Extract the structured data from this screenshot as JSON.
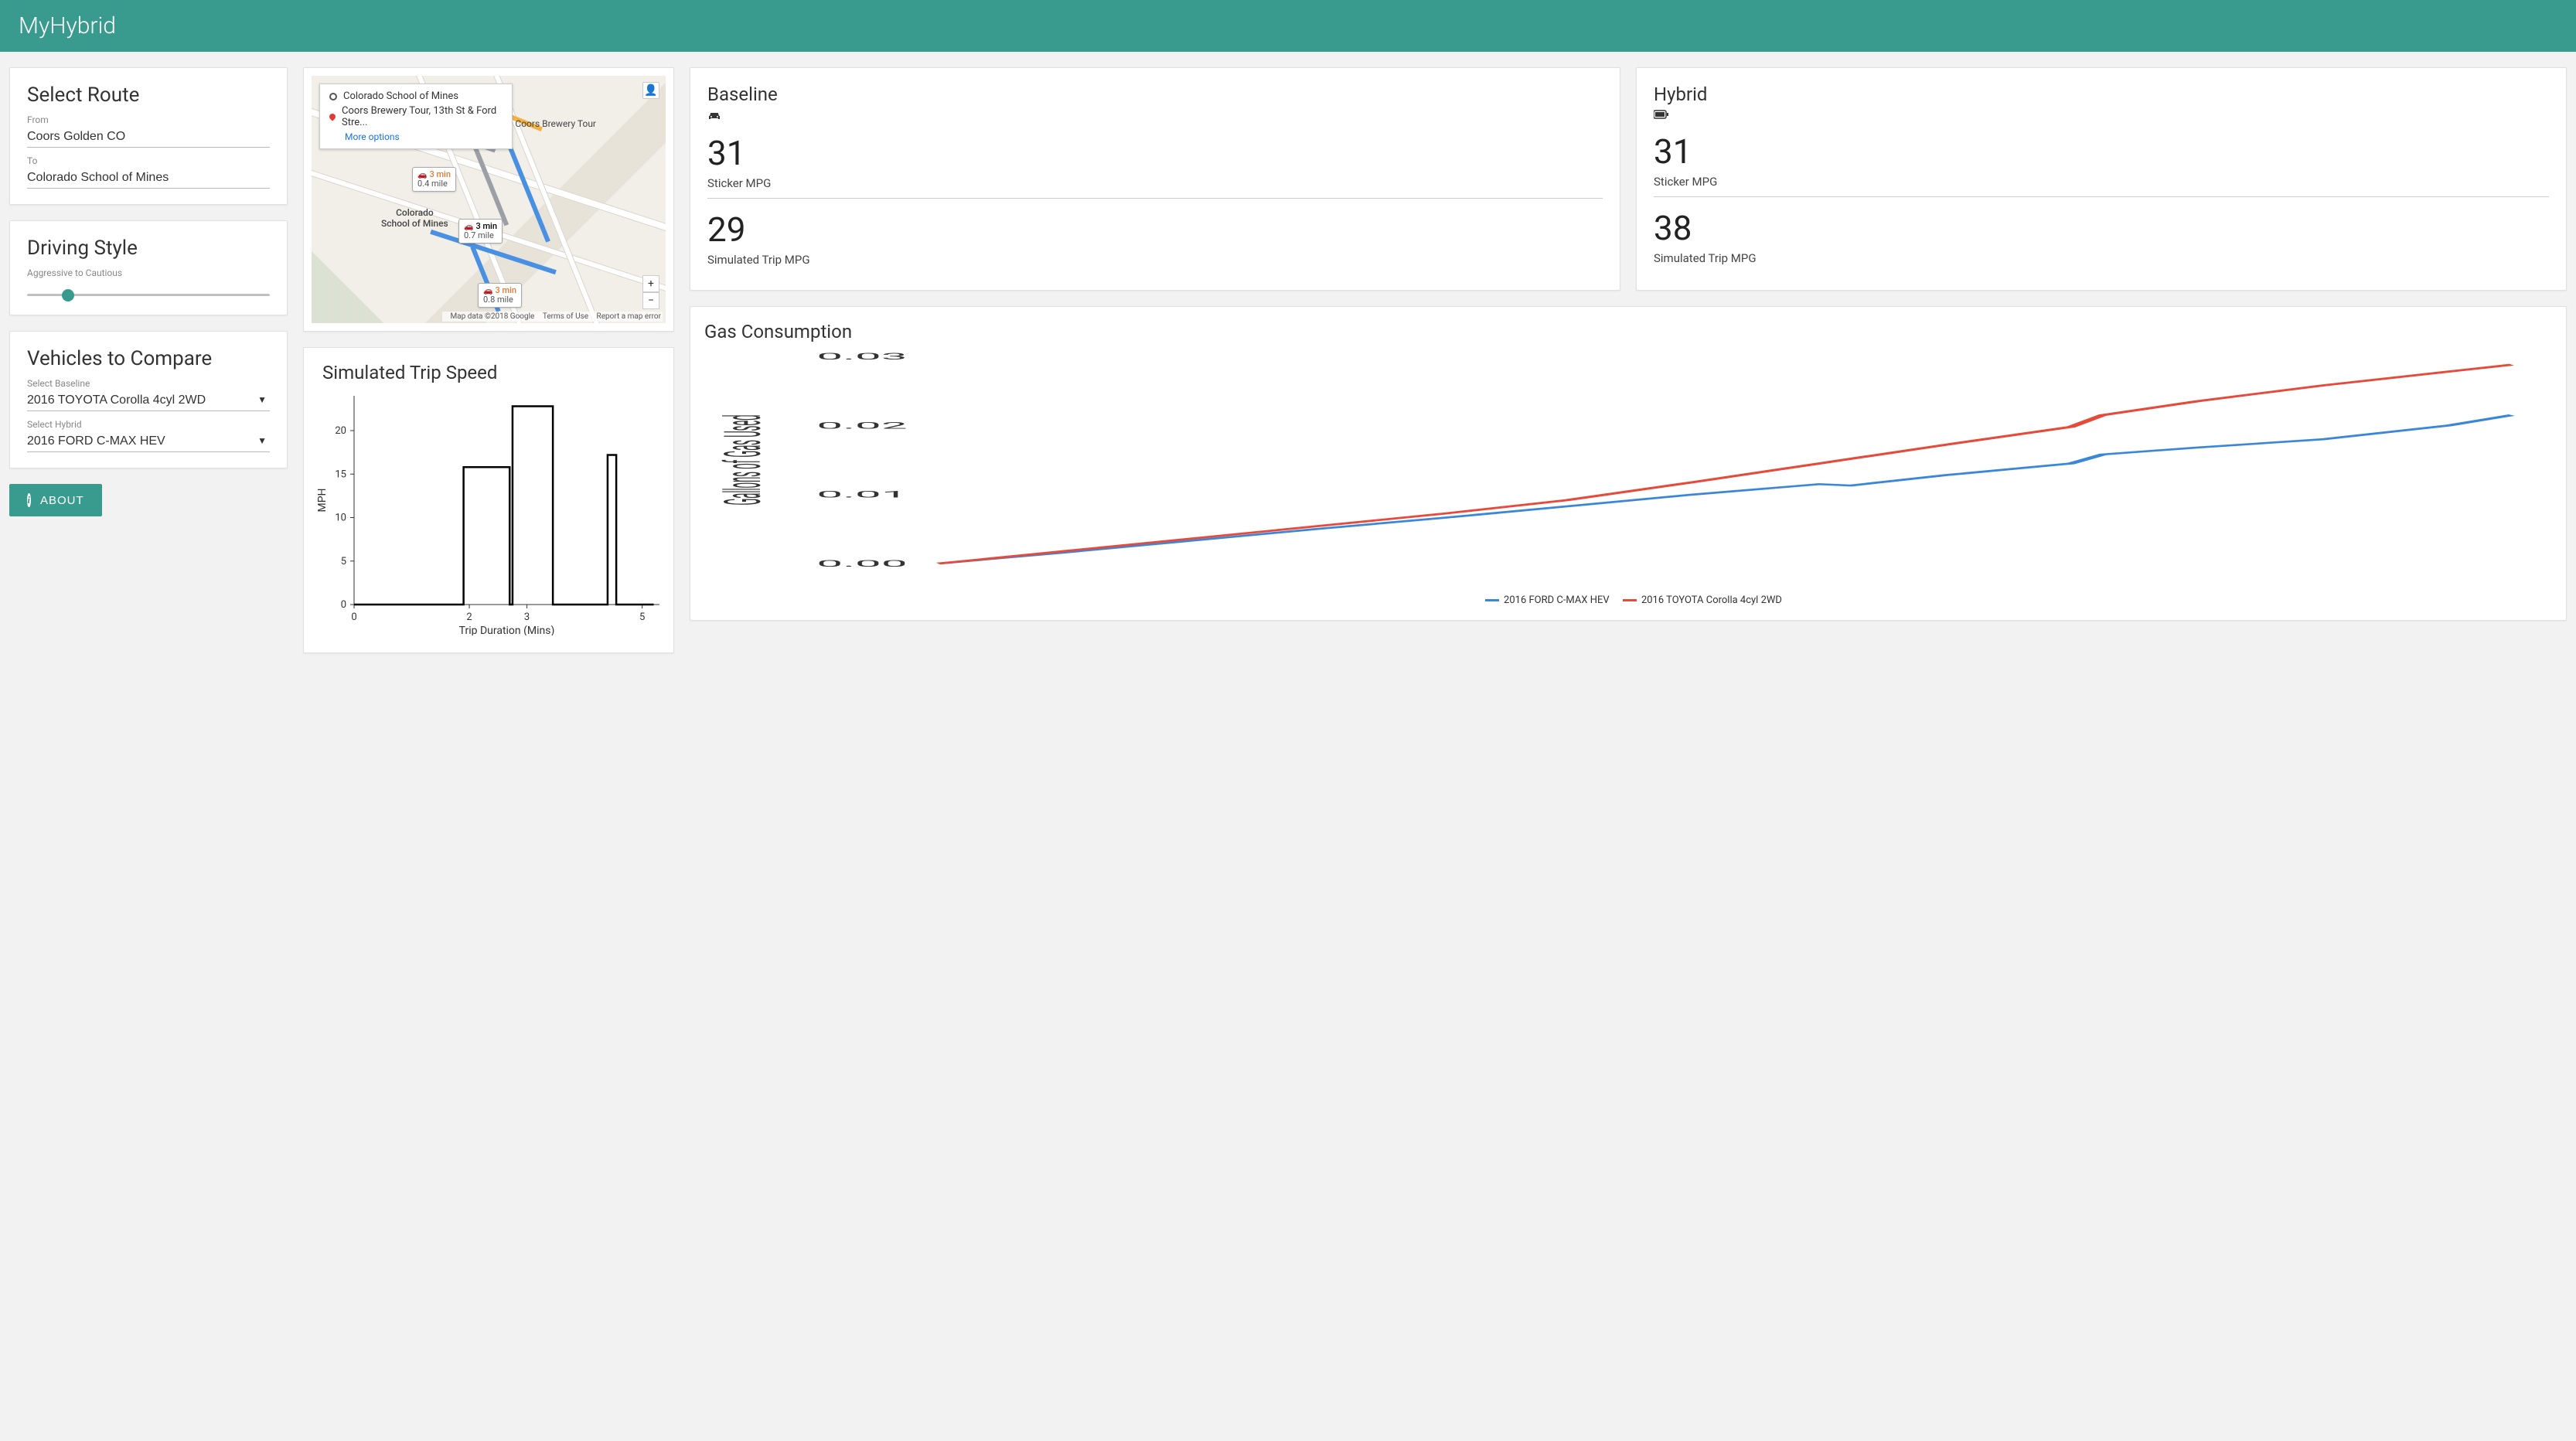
{
  "app": {
    "title": "MyHybrid"
  },
  "route_panel": {
    "heading": "Select Route",
    "from_label": "From",
    "from_value": "Coors Golden CO",
    "to_label": "To",
    "to_value": "Colorado School of Mines"
  },
  "driving_style": {
    "heading": "Driving Style",
    "hint": "Aggressive to Cautious",
    "value": 15
  },
  "vehicles": {
    "heading": "Vehicles to Compare",
    "baseline_label": "Select Baseline",
    "baseline_value": "2016 TOYOTA Corolla 4cyl 2WD",
    "hybrid_label": "Select Hybrid",
    "hybrid_value": "2016 FORD C-MAX HEV"
  },
  "about_label": "ABOUT",
  "map": {
    "origin": "Colorado School of Mines",
    "destination": "Coors Brewery Tour, 13th St & Ford Stre...",
    "more_options": "More options",
    "dest_poi": "Coors Brewery Tour",
    "origin_poi": "Colorado School of Mines",
    "routes": [
      {
        "time": "3 min",
        "dist": "0.4 mile",
        "highlight": true
      },
      {
        "time": "3 min",
        "dist": "0.7 mile",
        "highlight": false
      },
      {
        "time": "3 min",
        "dist": "0.8 mile",
        "highlight": true
      }
    ],
    "attribution": {
      "data": "Map data ©2018 Google",
      "terms": "Terms of Use",
      "report": "Report a map error"
    }
  },
  "metrics": {
    "baseline": {
      "title": "Baseline",
      "sticker_value": "31",
      "sticker_label": "Sticker MPG",
      "sim_value": "29",
      "sim_label": "Simulated Trip MPG"
    },
    "hybrid": {
      "title": "Hybrid",
      "sticker_value": "31",
      "sticker_label": "Sticker MPG",
      "sim_value": "38",
      "sim_label": "Simulated Trip MPG"
    }
  },
  "speed_chart": {
    "title": "Simulated Trip Speed",
    "xlabel": "Trip Duration (Mins)",
    "ylabel": "MPH",
    "y_ticks": [
      0,
      5,
      10,
      15,
      20
    ],
    "x_ticks": [
      0,
      2,
      3,
      5
    ]
  },
  "gas_chart": {
    "title": "Gas Consumption",
    "ylabel": "Gallons of Gas Used",
    "y_ticks": [
      "0.00",
      "0.01",
      "0.02",
      "0.03"
    ],
    "legend": {
      "a": "2016 FORD C-MAX HEV",
      "b": "2016 TOYOTA Corolla 4cyl 2WD"
    },
    "colors": {
      "a": "#3a86d8",
      "b": "#e64a3b"
    }
  },
  "chart_data": [
    {
      "type": "line",
      "title": "Simulated Trip Speed",
      "xlabel": "Trip Duration (Mins)",
      "ylabel": "MPH",
      "xlim": [
        0,
        5.3
      ],
      "ylim": [
        0,
        24
      ],
      "series": [
        {
          "name": "speed",
          "x": [
            0,
            1.9,
            1.9,
            2.7,
            2.7,
            2.75,
            2.75,
            3.45,
            3.45,
            4.4,
            4.4,
            4.55,
            4.55,
            5.2
          ],
          "y": [
            0,
            0,
            15.8,
            15.8,
            0,
            0,
            22.8,
            22.8,
            0,
            0,
            17.2,
            17.2,
            0,
            0
          ]
        }
      ]
    },
    {
      "type": "line",
      "title": "Gas Consumption",
      "ylabel": "Gallons of Gas Used",
      "xlim": [
        0,
        1
      ],
      "ylim": [
        0,
        0.03
      ],
      "series": [
        {
          "name": "2016 FORD C-MAX HEV",
          "color": "#3a86d8",
          "x": [
            0,
            0.08,
            0.16,
            0.24,
            0.32,
            0.4,
            0.48,
            0.56,
            0.58,
            0.64,
            0.72,
            0.74,
            0.8,
            0.88,
            0.96,
            1.0
          ],
          "y": [
            0,
            0.0016,
            0.0033,
            0.005,
            0.0066,
            0.0083,
            0.01,
            0.0115,
            0.0113,
            0.0128,
            0.0145,
            0.0158,
            0.0168,
            0.018,
            0.02,
            0.0215
          ]
        },
        {
          "name": "2016 TOYOTA Corolla 4cyl 2WD",
          "color": "#e64a3b",
          "x": [
            0,
            0.08,
            0.16,
            0.24,
            0.32,
            0.4,
            0.48,
            0.56,
            0.64,
            0.72,
            0.74,
            0.8,
            0.88,
            0.96,
            1.0
          ],
          "y": [
            0,
            0.0018,
            0.0036,
            0.0054,
            0.0072,
            0.0092,
            0.0118,
            0.0145,
            0.0172,
            0.0198,
            0.0215,
            0.0235,
            0.0258,
            0.0278,
            0.0288
          ]
        }
      ]
    }
  ]
}
